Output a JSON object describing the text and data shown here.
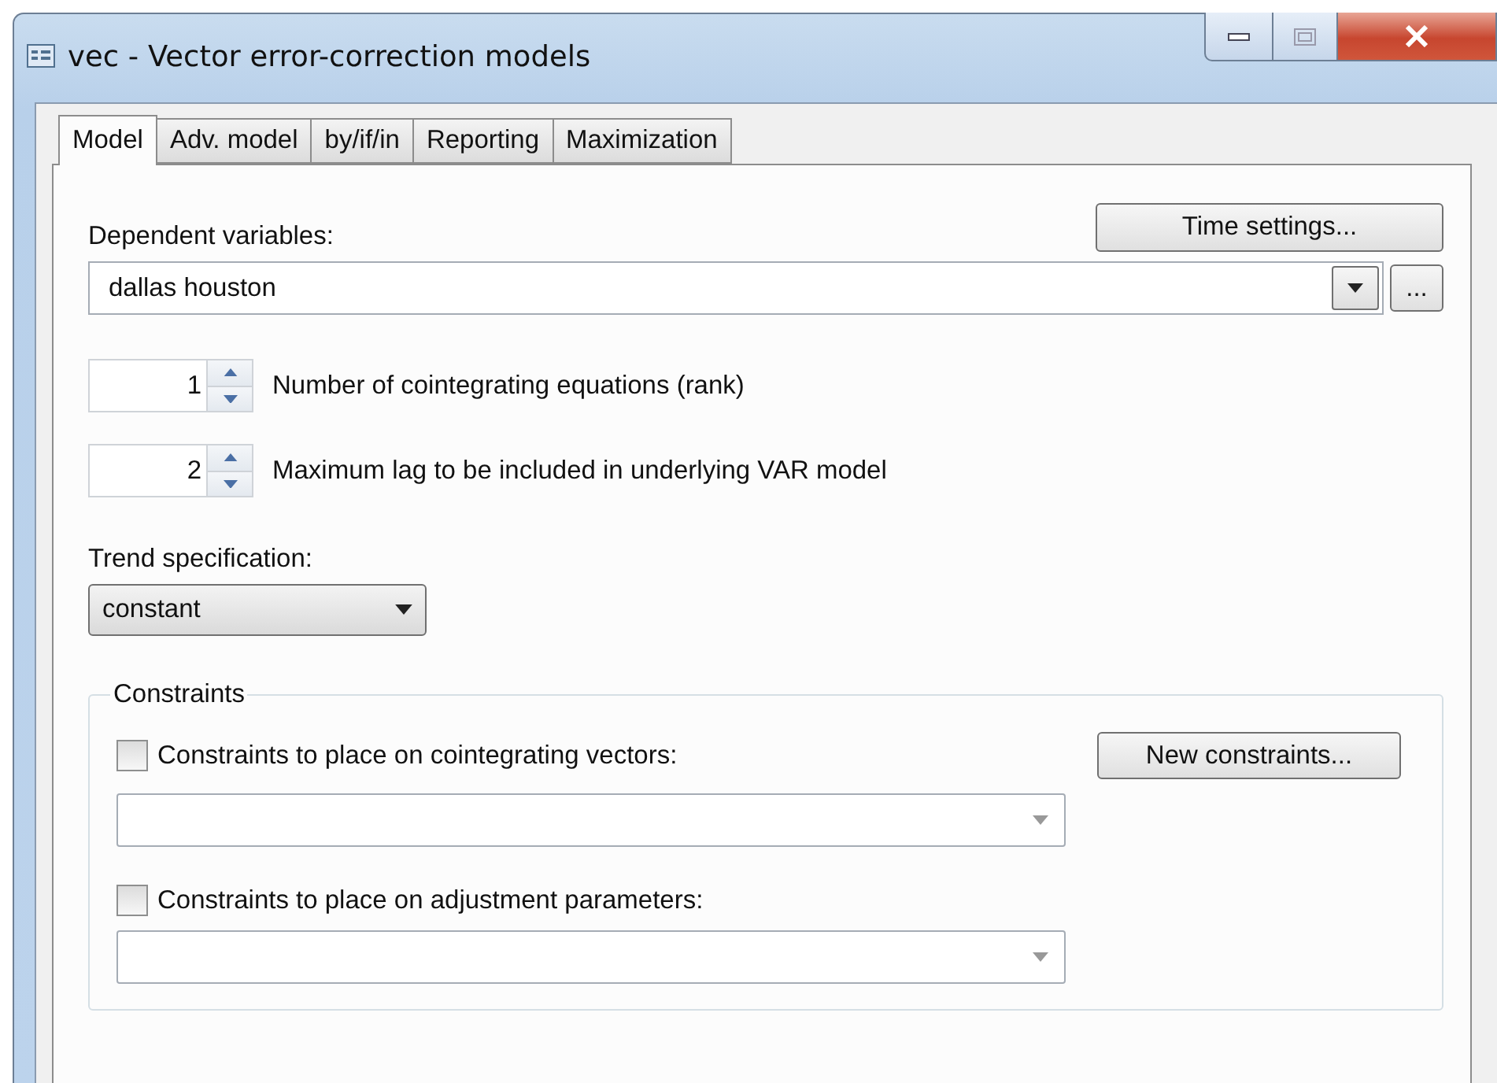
{
  "window": {
    "title": "vec - Vector error-correction models"
  },
  "tabs": [
    {
      "label": "Model",
      "selected": true
    },
    {
      "label": "Adv. model",
      "selected": false
    },
    {
      "label": "by/if/in",
      "selected": false
    },
    {
      "label": "Reporting",
      "selected": false
    },
    {
      "label": "Maximization",
      "selected": false
    }
  ],
  "time_settings_button": "Time settings...",
  "dependent_variables": {
    "label": "Dependent variables:",
    "value": "dallas houston",
    "browse_button": "..."
  },
  "spinners": [
    {
      "value": "1",
      "label": "Number of cointegrating equations (rank)"
    },
    {
      "value": "2",
      "label": "Maximum lag to be included in underlying VAR model"
    }
  ],
  "trend": {
    "label": "Trend specification:",
    "value": "constant"
  },
  "constraints": {
    "title": "Constraints",
    "new_button": "New constraints...",
    "items": [
      {
        "label": "Constraints to place on cointegrating vectors:",
        "checked": false
      },
      {
        "label": "Constraints to place on adjustment parameters:",
        "checked": false
      }
    ]
  }
}
